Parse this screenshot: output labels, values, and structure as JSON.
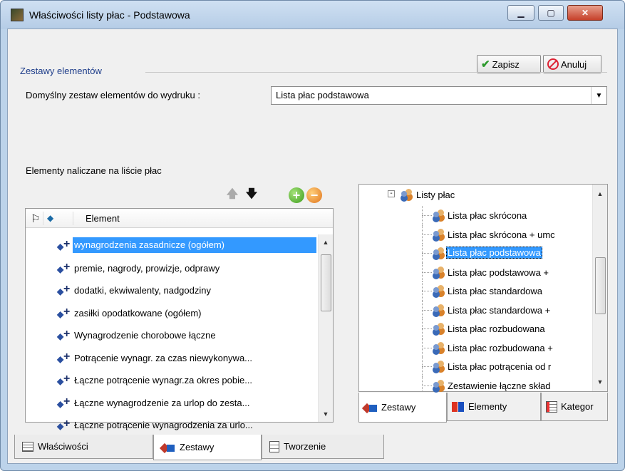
{
  "window": {
    "title": "Właściwości listy płac - Podstawowa",
    "minimize_label": "▁",
    "maximize_label": "▢",
    "close_label": "✕"
  },
  "toolbar": {
    "save_label": "Zapisz",
    "cancel_label": "Anuluj"
  },
  "group": {
    "title": "Zestawy elementów",
    "default_set_label": "Domyślny zestaw elementów do wydruku :",
    "default_set_value": "Lista płac podstawowa",
    "elements_label": "Elementy naliczane na liście płac"
  },
  "left_list": {
    "column_header": "Element",
    "rows": [
      "wynagrodzenia zasadnicze (ogółem)",
      "premie, nagrody, prowizje, odprawy",
      "dodatki, ekwiwalenty, nadgodziny",
      "zasiłki opodatkowane (ogółem)",
      "Wynagrodzenie chorobowe łączne",
      "Potrącenie wynagr. za czas niewykonywa...",
      "Łączne potrącenie wynagr.za okres pobie...",
      "Łączne wynagrodzenie za urlop do zesta...",
      "Łączne potrącenie wynagrodzenia za urlo..."
    ],
    "selected_index": 0
  },
  "tree": {
    "root": "Listy płac",
    "items": [
      "Lista płac skrócona",
      "Lista płac skrócona + umc",
      "Lista płac podstawowa",
      "Lista płac podstawowa +",
      "Lista płac standardowa",
      "Lista płac standardowa +",
      "Lista płac rozbudowana",
      "Lista płac rozbudowana +",
      "Lista płac potrącenia od r",
      "Zestawienie łączne skład"
    ],
    "selected_index": 2
  },
  "tree_tabs": [
    "Zestawy",
    "Elementy",
    "Kategor"
  ],
  "main_tabs": [
    "Właściwości",
    "Zestawy",
    "Tworzenie"
  ],
  "colors": {
    "selection": "#3399ff",
    "group_title": "#1e3d8a"
  }
}
